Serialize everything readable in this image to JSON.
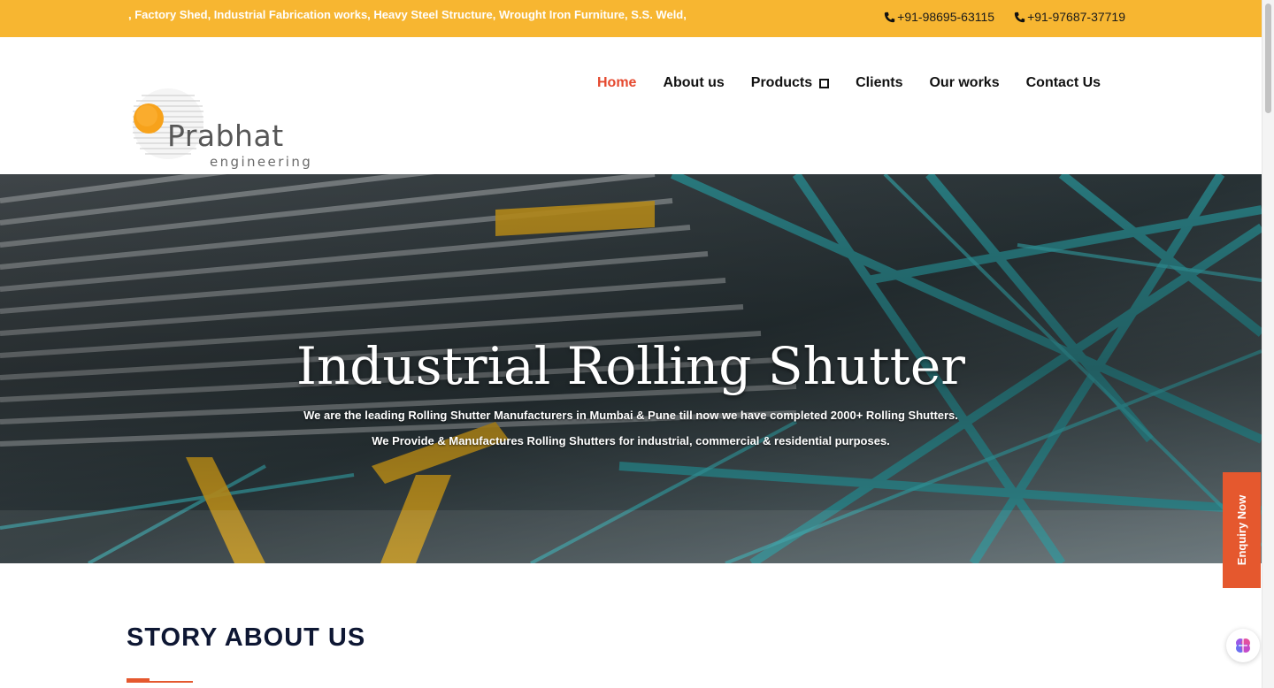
{
  "topbar": {
    "marquee": ", Factory Shed, Industrial Fabrication works, Heavy Steel Structure, Wrought Iron Furniture, S.S. Weld,",
    "phones": [
      "+91-98695-63115",
      "+91-97687-37719"
    ],
    "icon": "phone-icon"
  },
  "brand": {
    "name": "Prabhat",
    "tagline": "engineering"
  },
  "nav": {
    "items": [
      {
        "label": "Home",
        "active": true
      },
      {
        "label": "About us"
      },
      {
        "label": "Products",
        "icon": "square-icon"
      },
      {
        "label": "Clients"
      },
      {
        "label": "Our works"
      },
      {
        "label": "Contact Us"
      }
    ]
  },
  "hero": {
    "title": "Industrial Rolling Shutter",
    "line1": "We are the leading Rolling Shutter Manufacturers in Mumbai & Pune till now we have completed 2000+ Rolling Shutters.",
    "line2": "We Provide & Manufactures Rolling Shutters for industrial, commercial & residential purposes."
  },
  "enquiry": {
    "label": "Enquiry Now"
  },
  "story": {
    "heading": "STORY ABOUT US"
  },
  "colors": {
    "accent_yellow": "#f7b631",
    "accent_orange": "#e5582e",
    "nav_active": "#e5492f",
    "heading_navy": "#0e1733"
  },
  "icons": [
    "phone-icon",
    "square-icon",
    "chat-brain-icon"
  ]
}
